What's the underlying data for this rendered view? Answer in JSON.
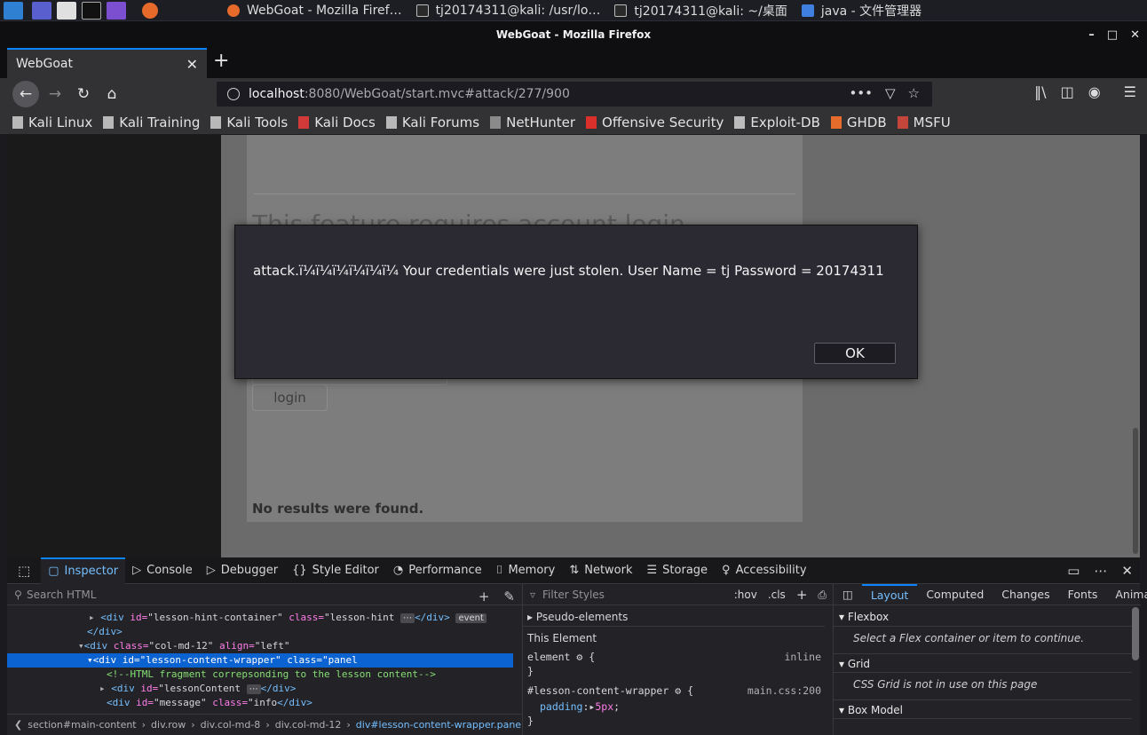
{
  "taskbar": {
    "tasks": [
      {
        "label": "WebGoat - Mozilla Firef…"
      },
      {
        "label": "tj20174311@kali: /usr/lo…"
      },
      {
        "label": "tj20174311@kali: ~/桌面"
      },
      {
        "label": "java - 文件管理器"
      }
    ]
  },
  "window": {
    "title": "WebGoat - Mozilla Firefox",
    "controls": [
      "–",
      "□",
      "✕"
    ]
  },
  "tab": {
    "label": "WebGoat",
    "close": "✕",
    "new_tab": "+"
  },
  "nav": {
    "url_host": "localhost",
    "url_rest": ":8080/WebGoat/start.mvc#attack/277/900",
    "more": "•••"
  },
  "bookmarks": [
    {
      "label": "Kali Linux",
      "color": "#b8b8b8"
    },
    {
      "label": "Kali Training",
      "color": "#b8b8b8"
    },
    {
      "label": "Kali Tools",
      "color": "#b8b8b8"
    },
    {
      "label": "Kali Docs",
      "color": "#d23a3a"
    },
    {
      "label": "Kali Forums",
      "color": "#b8b8b8"
    },
    {
      "label": "NetHunter",
      "color": "#8a8a8a"
    },
    {
      "label": "Offensive Security",
      "color": "#d9302b"
    },
    {
      "label": "Exploit-DB",
      "color": "#bcbcbc"
    },
    {
      "label": "GHDB",
      "color": "#e56c2b"
    },
    {
      "label": "MSFU",
      "color": "#c4463b"
    }
  ],
  "page": {
    "heading": "This feature requires account login",
    "login_label": "login",
    "no_results": "No results were found."
  },
  "dialog": {
    "message": "attack.ï¼ï¼ï¼ï¼ï¼ï¼ Your credentials were just stolen. User Name = tj Password = 20174311",
    "ok_label": "OK"
  },
  "devtools": {
    "tabs": [
      {
        "label": "Inspector",
        "icon": "▢"
      },
      {
        "label": "Console",
        "icon": "▷"
      },
      {
        "label": "Debugger",
        "icon": "▷"
      },
      {
        "label": "Style Editor",
        "icon": "{}"
      },
      {
        "label": "Performance",
        "icon": "◔"
      },
      {
        "label": "Memory",
        "icon": "⌷"
      },
      {
        "label": "Network",
        "icon": "⇅"
      },
      {
        "label": "Storage",
        "icon": "☰"
      },
      {
        "label": "Accessibility",
        "icon": "♀"
      }
    ],
    "search_placeholder": "Search HTML",
    "markup": {
      "l1_tag_open": "<div ",
      "l1_attr1": "id=",
      "l1_val1": "\"lesson-hint-container\" ",
      "l1_attr2": "class=",
      "l1_val2": "\"lesson-hint",
      "l1_close": "</div>",
      "l1_event": "event",
      "l2": "</div>",
      "l3_tag_open": "<div ",
      "l3_attr1": "class=",
      "l3_val1": "\"col-md-12\" ",
      "l3_attr2": "align=",
      "l3_val2": "\"left\"",
      "l4_tag_open": "<div ",
      "l4_attr1": "id=",
      "l4_val1": "\"lesson-content-wrapper\" ",
      "l4_attr2": "class=",
      "l4_val2": "\"panel",
      "l5_comment": "<!--HTML fragment correpsonding to the lesson content-->",
      "l6_tag_open": "<div ",
      "l6_attr1": "id=",
      "l6_val1": "\"lessonContent",
      "l6_close": "</div>",
      "l7_tag_open": "<div ",
      "l7_attr1": "id=",
      "l7_val1": "\"message\" ",
      "l7_attr2": "class=",
      "l7_val2": "\"info",
      "l7_close": "</div>"
    },
    "breadcrumb": [
      "section#main-content",
      "div.row",
      "div.col-md-8",
      "div.col-md-12",
      "div#lesson-content-wrapper.panel"
    ],
    "rules": {
      "filter_placeholder": "Filter Styles",
      "hov": ":hov",
      "cls": ".cls",
      "pseudo_elements": "Pseudo-elements",
      "this_element": "This Element",
      "r1_selector": "element",
      "r1_src": "inline",
      "r2_selector": "#lesson-content-wrapper",
      "r2_src": "main.css:200",
      "r2_prop": "padding",
      "r2_value": "5px",
      "brace_open": "{",
      "brace_close": "}"
    },
    "layout": {
      "tabs": [
        "Layout",
        "Computed",
        "Changes",
        "Fonts",
        "Animat"
      ],
      "flexbox_title": "Flexbox",
      "flexbox_note": "Select a Flex container or item to continue.",
      "grid_title": "Grid",
      "grid_note": "CSS Grid is not in use on this page",
      "boxmodel_title": "Box Model"
    }
  }
}
